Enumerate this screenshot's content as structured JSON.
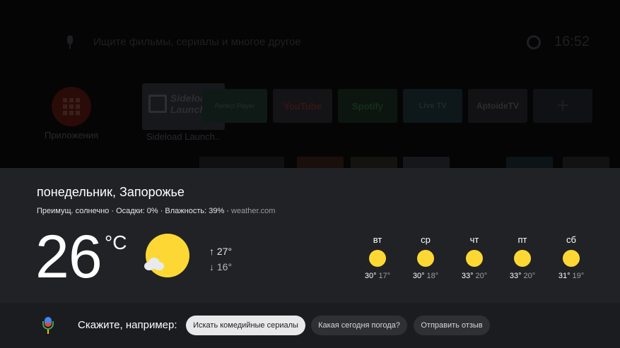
{
  "launcher": {
    "search_hint": "Ищите фильмы, сериалы и многое другое",
    "clock": "16:52",
    "apps_label": "Приложения",
    "focused_app_label": "Sideload Launch..",
    "focused_app_logo": "Sideload Launcher",
    "apps": [
      {
        "name": "Perfect Player"
      },
      {
        "name": "YouTube"
      },
      {
        "name": "Spotify"
      },
      {
        "name": "Live TV"
      },
      {
        "name": "AptoideTV"
      }
    ]
  },
  "weather": {
    "title": "понедельник, Запорожье",
    "summary": "Преимущ. солнечно · Осадки: 0% · Влажность: 39% · ",
    "source": "weather.com",
    "temperature": "26",
    "unit": "°C",
    "high": "↑ 27°",
    "low": "↓ 16°",
    "forecast": [
      {
        "day": "вт",
        "hi": "30°",
        "lo": "17°"
      },
      {
        "day": "ср",
        "hi": "30°",
        "lo": "18°"
      },
      {
        "day": "чт",
        "hi": "33°",
        "lo": "20°"
      },
      {
        "day": "пт",
        "hi": "33°",
        "lo": "20°"
      },
      {
        "day": "сб",
        "hi": "31°",
        "lo": "19°"
      }
    ]
  },
  "assistant": {
    "prompt": "Скажите, например:",
    "suggestions": [
      "Искать комедийные сериалы",
      "Какая сегодня погода?",
      "Отправить отзыв"
    ]
  },
  "colors": {
    "sun": "#fdd835",
    "panel": "#212226",
    "assistant_bar": "#1b1c1f"
  }
}
